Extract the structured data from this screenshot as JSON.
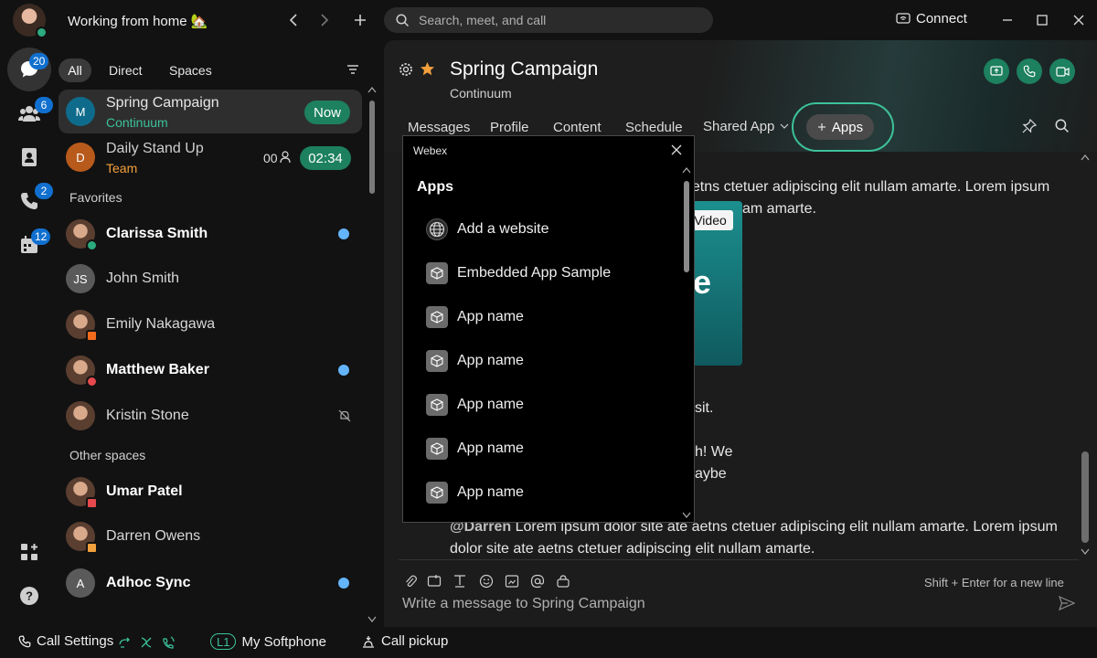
{
  "titlebar": {
    "status_text": "Working from home 🏡",
    "search_placeholder": "Search, meet, and call",
    "connect_label": "Connect"
  },
  "rail": {
    "messaging_badge": "20",
    "teams_badge": "6",
    "calling_badge": "2",
    "meetings_badge": "12"
  },
  "list": {
    "filters": [
      "All",
      "Direct",
      "Spaces"
    ],
    "spaces": [
      {
        "initial": "M",
        "name": "Spring Campaign",
        "team": "Continuum",
        "badge": "Now",
        "team_color": "#3cc29a"
      },
      {
        "initial": "D",
        "name": "Daily Stand Up",
        "team": "Team",
        "count": "00",
        "timer": "02:34",
        "team_color": "#f2a03c"
      }
    ],
    "favorites_label": "Favorites",
    "favorites": [
      {
        "name": "Clarissa Smith",
        "bold": true,
        "unread": true
      },
      {
        "initial": "JS",
        "name": "John Smith",
        "bold": false
      },
      {
        "name": "Emily Nakagawa",
        "bold": false
      },
      {
        "name": "Matthew Baker",
        "bold": true,
        "unread": true
      },
      {
        "name": "Kristin Stone",
        "bold": false,
        "muted": true
      }
    ],
    "other_label": "Other spaces",
    "others": [
      {
        "name": "Umar Patel",
        "bold": true
      },
      {
        "name": "Darren Owens",
        "bold": false
      },
      {
        "initial": "A",
        "name": "Adhoc Sync",
        "bold": true,
        "unread": true
      }
    ]
  },
  "bottombar": {
    "call_settings": "Call Settings",
    "line_badge": "L1",
    "softphone": "My Softphone",
    "call_pickup": "Call pickup"
  },
  "space": {
    "title": "Spring Campaign",
    "subtitle": "Continuum",
    "tabs": [
      "Messages",
      "Profile",
      "Content",
      "Schedule",
      "Shared App"
    ],
    "apps_tab": "Apps"
  },
  "messages": {
    "line1": "aetns ctetuer adipiscing elit nullam amarte. Lorem ipsum",
    "line2": "am amarte.",
    "video_label": "Video",
    "video_letter": "e",
    "line3": "sit.",
    "line4": "h! We",
    "line5": "aybe",
    "mention": "@Darren",
    "line6": " Lorem ipsum dolor site ate aetns ctetuer adipiscing elit nullam amarte. Lorem ipsum",
    "line7": "dolor site ate aetns ctetuer adipiscing elit nullam amarte."
  },
  "composer": {
    "hint": "Shift + Enter for a new line",
    "placeholder": "Write a message to Spring Campaign"
  },
  "popup": {
    "window_title": "Webex",
    "heading": "Apps",
    "items": [
      "Add a website",
      "Embedded App Sample",
      "App name",
      "App name",
      "App name",
      "App name",
      "App name"
    ]
  },
  "colors": {
    "accent": "#3cc29a",
    "unread": "#64b4fa",
    "badge": "#1170cf",
    "call_green": "#1d805f"
  }
}
